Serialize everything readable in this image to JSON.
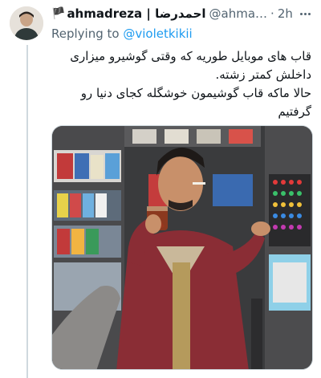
{
  "tweet": {
    "flag_emoji": "🏴",
    "display_name": "ahmadreza | احمدرضا",
    "handle": "@ahma…",
    "separator": "·",
    "time": "2h",
    "reply_prefix": "Replying to ",
    "reply_to": "@violetkikii",
    "text_lines": [
      "قاب های موبایل طوریه که وقتی گوشیرو میزاری",
      "داخلش کمتر زشته.",
      "حالا ماکه قاب گوشیمون خوشگله کجای دنیا رو",
      "گرفتیم"
    ]
  },
  "colors": {
    "link": "#1d9bf0",
    "secondary_text": "#536471",
    "primary_text": "#0f1419",
    "thread_line": "#cfd9de"
  },
  "icons": {
    "more": "more-horizontal-icon",
    "flag": "flag-icon"
  }
}
